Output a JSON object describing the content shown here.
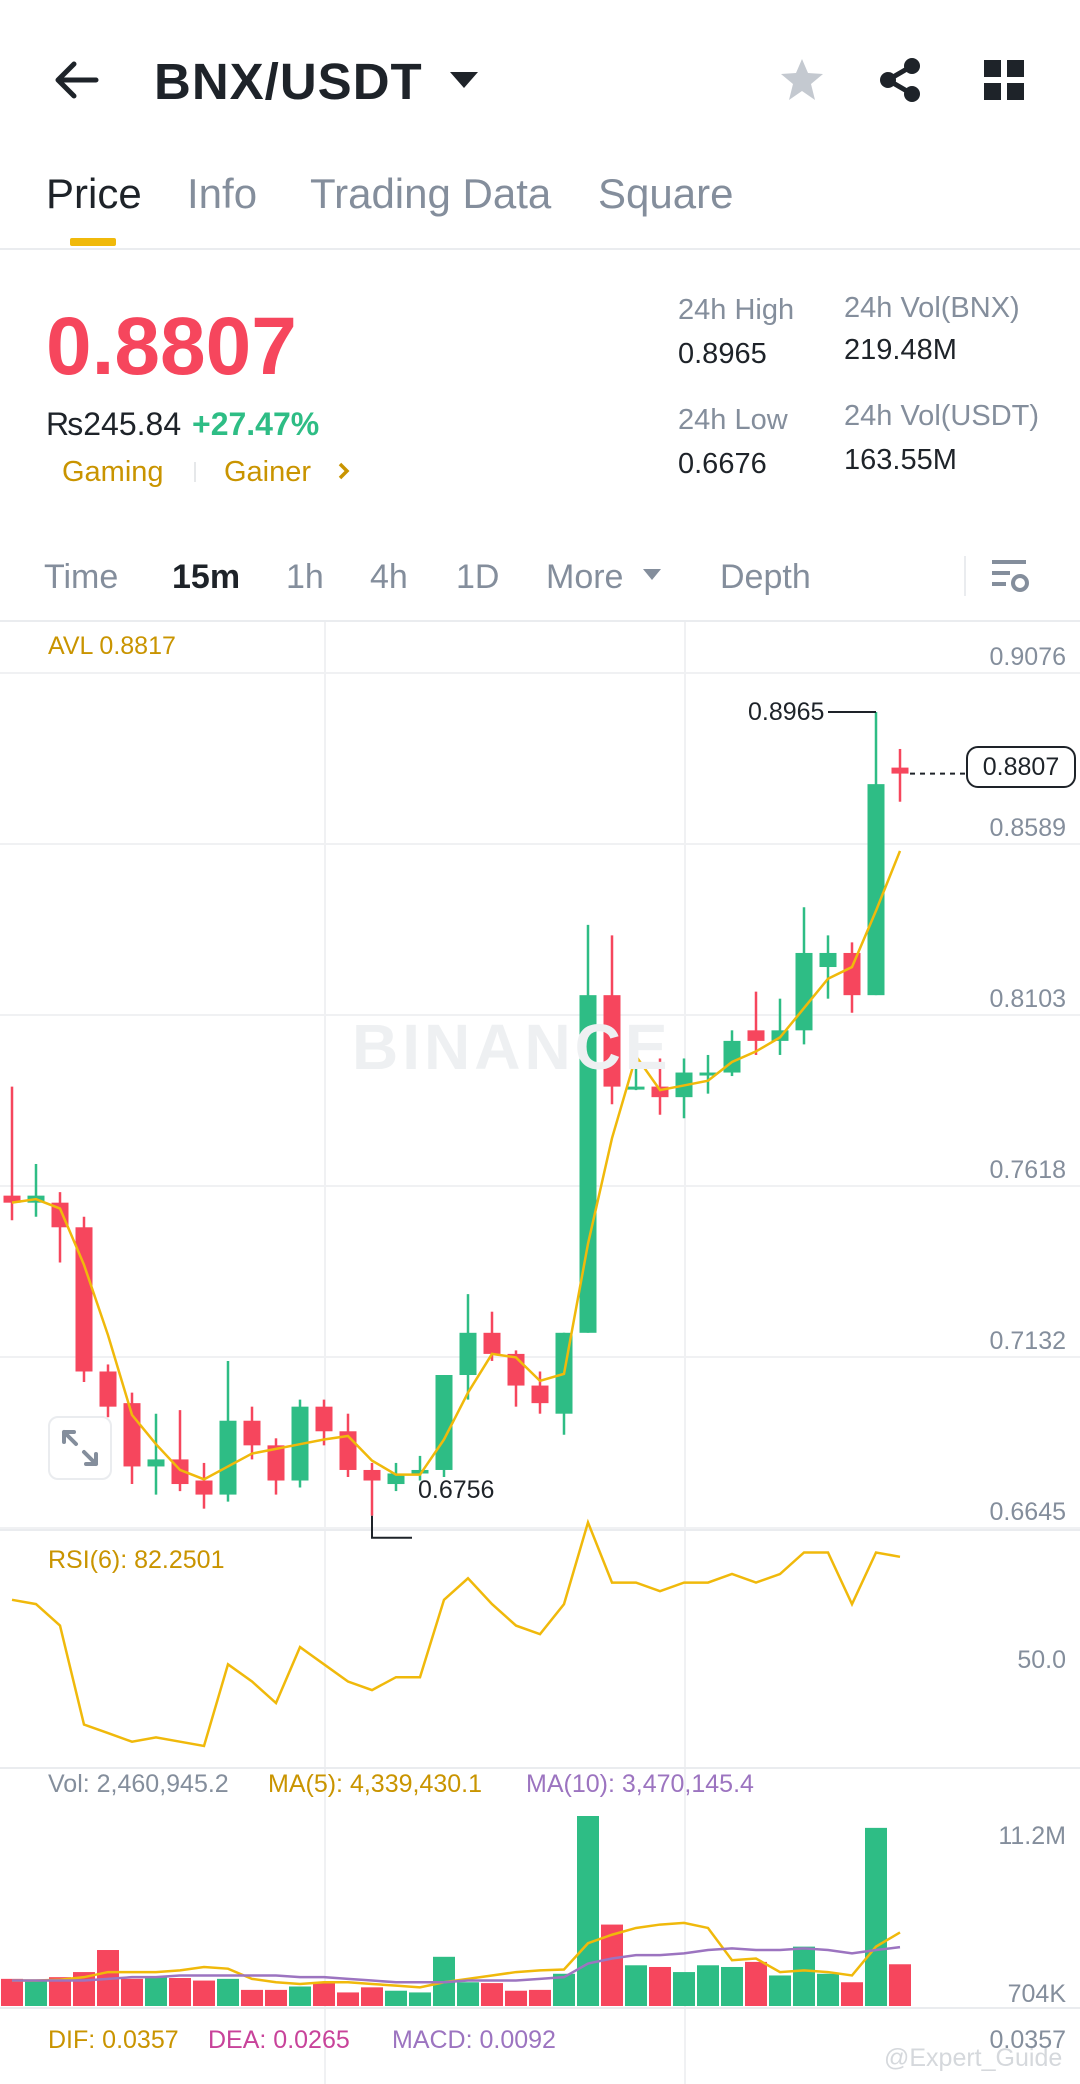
{
  "header": {
    "pair": "BNX/USDT",
    "back_icon": "arrow-left-icon",
    "dropdown_icon": "caret-down-icon",
    "favorite_icon": "star-icon",
    "share_icon": "share-icon",
    "menu_icon": "grid-icon"
  },
  "tabs": [
    {
      "label": "Price",
      "active": true
    },
    {
      "label": "Info"
    },
    {
      "label": "Trading Data"
    },
    {
      "label": "Square"
    }
  ],
  "ticker": {
    "last_price": "0.8807",
    "fiat_price": "₨245.84",
    "change_pct": "+27.47%",
    "tags": [
      "Gaming",
      "Gainer"
    ],
    "high_label": "24h High",
    "high": "0.8965",
    "low_label": "24h Low",
    "low": "0.6676",
    "vol_base_label": "24h Vol(BNX)",
    "vol_base": "219.48M",
    "vol_quote_label": "24h Vol(USDT)",
    "vol_quote": "163.55M",
    "price_color": "#f6465d",
    "up_color": "#2ebd85",
    "accent": "#f0b90b"
  },
  "intervals": {
    "items": [
      "Time",
      "15m",
      "1h",
      "4h",
      "1D",
      "More",
      "Depth"
    ],
    "active": "15m",
    "settings_icon": "chart-settings-icon"
  },
  "chart": {
    "avl_label": "AVL 0.8817",
    "price_axis": [
      "0.9076",
      "0.8589",
      "0.8103",
      "0.7618",
      "0.7132",
      "0.6645"
    ],
    "current_price_tag": "0.8807",
    "high_marker": "0.8965",
    "low_marker": "0.6756",
    "watermark": "BINANCE",
    "expand_icon": "expand-icon",
    "rsi_label": "RSI(6): 82.2501",
    "rsi_axis": "50.0",
    "vol_label": "Vol: 2,460,945.2",
    "ma5_label": "MA(5): 4,339,430.1",
    "ma10_label": "MA(10): 3,470,145.4",
    "vol_axis_top": "11.2M",
    "vol_axis_bottom": "704K",
    "dif_label": "DIF: 0.0357",
    "dea_label": "DEA: 0.0265",
    "macd_label": "MACD: 0.0092",
    "macd_axis": "0.0357",
    "credit": "@Expert_Guide"
  },
  "chart_data": {
    "type": "candlestick",
    "interval": "15m",
    "ylim": [
      0.6645,
      0.9076
    ],
    "candles": [
      {
        "o": 0.759,
        "c": 0.757,
        "h": 0.79,
        "l": 0.752
      },
      {
        "o": 0.757,
        "c": 0.759,
        "h": 0.768,
        "l": 0.753
      },
      {
        "o": 0.757,
        "c": 0.75,
        "h": 0.76,
        "l": 0.74
      },
      {
        "o": 0.75,
        "c": 0.709,
        "h": 0.753,
        "l": 0.706
      },
      {
        "o": 0.709,
        "c": 0.699,
        "h": 0.711,
        "l": 0.696
      },
      {
        "o": 0.7,
        "c": 0.682,
        "h": 0.703,
        "l": 0.677
      },
      {
        "o": 0.682,
        "c": 0.684,
        "h": 0.697,
        "l": 0.674
      },
      {
        "o": 0.684,
        "c": 0.677,
        "h": 0.698,
        "l": 0.675
      },
      {
        "o": 0.678,
        "c": 0.674,
        "h": 0.683,
        "l": 0.67
      },
      {
        "o": 0.674,
        "c": 0.695,
        "h": 0.712,
        "l": 0.672
      },
      {
        "o": 0.695,
        "c": 0.688,
        "h": 0.699,
        "l": 0.684
      },
      {
        "o": 0.688,
        "c": 0.678,
        "h": 0.69,
        "l": 0.674
      },
      {
        "o": 0.678,
        "c": 0.699,
        "h": 0.701,
        "l": 0.676
      },
      {
        "o": 0.699,
        "c": 0.692,
        "h": 0.701,
        "l": 0.688
      },
      {
        "o": 0.692,
        "c": 0.681,
        "h": 0.697,
        "l": 0.679
      },
      {
        "o": 0.681,
        "c": 0.678,
        "h": 0.683,
        "l": 0.668
      },
      {
        "o": 0.677,
        "c": 0.68,
        "h": 0.683,
        "l": 0.675
      },
      {
        "o": 0.68,
        "c": 0.681,
        "h": 0.685,
        "l": 0.678
      },
      {
        "o": 0.681,
        "c": 0.708,
        "h": 0.708,
        "l": 0.679
      },
      {
        "o": 0.708,
        "c": 0.72,
        "h": 0.731,
        "l": 0.701
      },
      {
        "o": 0.72,
        "c": 0.714,
        "h": 0.726,
        "l": 0.712
      },
      {
        "o": 0.714,
        "c": 0.705,
        "h": 0.715,
        "l": 0.699
      },
      {
        "o": 0.705,
        "c": 0.7,
        "h": 0.709,
        "l": 0.697
      },
      {
        "o": 0.697,
        "c": 0.72,
        "h": 0.72,
        "l": 0.691
      },
      {
        "o": 0.72,
        "c": 0.816,
        "h": 0.836,
        "l": 0.72
      },
      {
        "o": 0.816,
        "c": 0.79,
        "h": 0.833,
        "l": 0.785
      },
      {
        "o": 0.79,
        "c": 0.79,
        "h": 0.804,
        "l": 0.789
      },
      {
        "o": 0.79,
        "c": 0.787,
        "h": 0.798,
        "l": 0.782
      },
      {
        "o": 0.787,
        "c": 0.794,
        "h": 0.798,
        "l": 0.781
      },
      {
        "o": 0.794,
        "c": 0.794,
        "h": 0.799,
        "l": 0.788
      },
      {
        "o": 0.794,
        "c": 0.803,
        "h": 0.806,
        "l": 0.793
      },
      {
        "o": 0.806,
        "c": 0.803,
        "h": 0.817,
        "l": 0.799
      },
      {
        "o": 0.803,
        "c": 0.806,
        "h": 0.815,
        "l": 0.799
      },
      {
        "o": 0.806,
        "c": 0.828,
        "h": 0.841,
        "l": 0.802
      },
      {
        "o": 0.824,
        "c": 0.828,
        "h": 0.833,
        "l": 0.815
      },
      {
        "o": 0.828,
        "c": 0.816,
        "h": 0.831,
        "l": 0.811
      },
      {
        "o": 0.816,
        "c": 0.876,
        "h": 0.8965,
        "l": 0.816
      },
      {
        "o": 0.8807,
        "c": 0.879,
        "h": 0.886,
        "l": 0.871
      }
    ],
    "rsi6": [
      64,
      63,
      58,
      35,
      33,
      31,
      32,
      31,
      30,
      49,
      45,
      40,
      53,
      49,
      45,
      43,
      46,
      46,
      64,
      69,
      63,
      58,
      56,
      63,
      82,
      68,
      68,
      66,
      68,
      68,
      70,
      68,
      70,
      75,
      75,
      63,
      75,
      74
    ],
    "volume_k": [
      1600,
      1550,
      1700,
      2000,
      3300,
      1600,
      1700,
      1650,
      1500,
      1600,
      950,
      950,
      1150,
      1400,
      800,
      1100,
      900,
      800,
      2900,
      1400,
      1350,
      900,
      950,
      1900,
      11200,
      4800,
      2400,
      2300,
      2000,
      2400,
      2300,
      2600,
      1800,
      3500,
      1900,
      1400,
      10500,
      2460
    ],
    "ma5_k": [
      1500,
      1500,
      1550,
      1700,
      2000,
      2000,
      2000,
      2100,
      2300,
      2200,
      1600,
      1400,
      1300,
      1400,
      1400,
      1300,
      1200,
      1100,
      1400,
      1600,
      1800,
      2000,
      2100,
      2150,
      3700,
      4200,
      4600,
      4800,
      4900,
      4600,
      2700,
      2800,
      2000,
      2100,
      2000,
      1800,
      3500,
      4339
    ],
    "ma10_k": [
      1500,
      1500,
      1500,
      1500,
      1600,
      1700,
      1700,
      1800,
      1800,
      1800,
      1800,
      1800,
      1700,
      1700,
      1600,
      1500,
      1400,
      1400,
      1400,
      1500,
      1500,
      1500,
      1600,
      1700,
      2500,
      2800,
      3000,
      3000,
      3100,
      3300,
      3400,
      3300,
      3300,
      3400,
      3300,
      3100,
      3300,
      3470
    ]
  }
}
